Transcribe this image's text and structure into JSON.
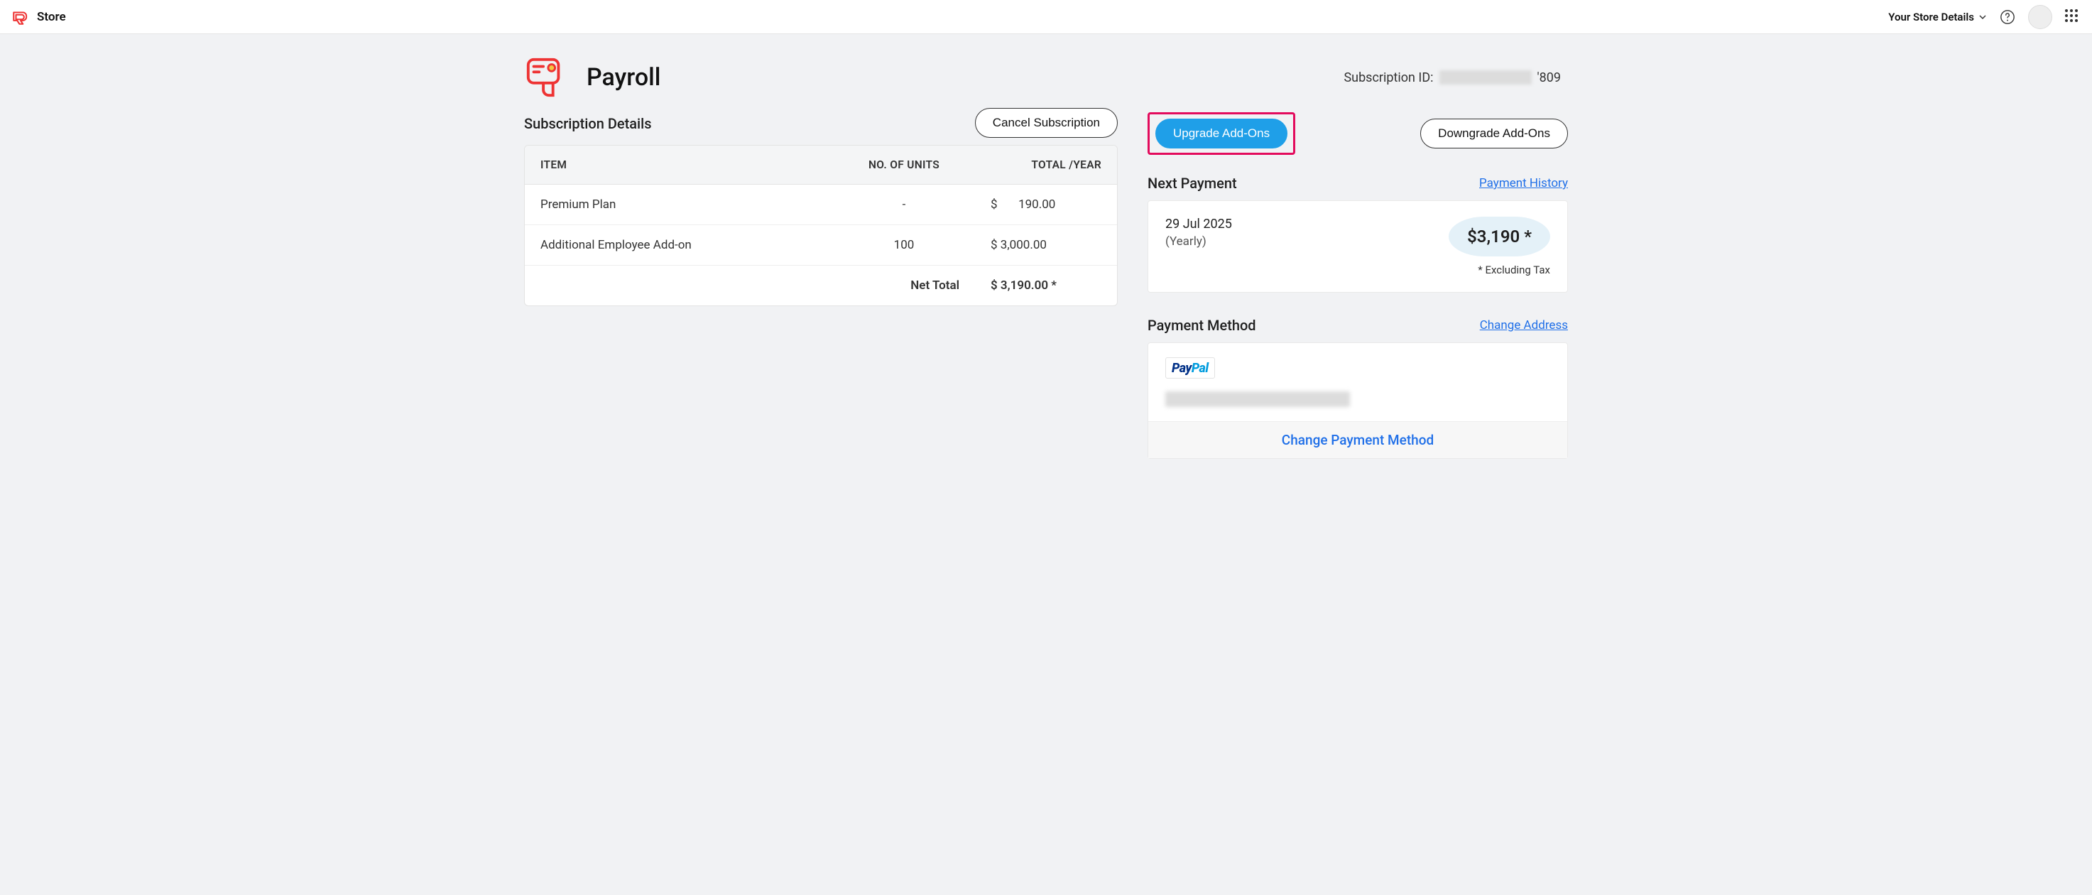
{
  "topbar": {
    "store_label": "Store",
    "store_details_label": "Your Store Details"
  },
  "header": {
    "title": "Payroll",
    "sub_id_label": "Subscription ID:",
    "sub_id_suffix": "'809"
  },
  "actions": {
    "cancel": "Cancel Subscription",
    "upgrade": "Upgrade Add-Ons",
    "downgrade": "Downgrade Add-Ons"
  },
  "details": {
    "heading": "Subscription Details",
    "cols": {
      "item": "ITEM",
      "units": "NO. OF UNITS",
      "total": "TOTAL /YEAR"
    },
    "rows": [
      {
        "item": "Premium Plan",
        "units": "-",
        "total": "$       190.00"
      },
      {
        "item": "Additional Employee Add-on",
        "units": "100",
        "total": "$ 3,000.00"
      }
    ],
    "net_total_label": "Net Total",
    "net_total_value": "$ 3,190.00 *"
  },
  "next_payment": {
    "heading": "Next Payment",
    "history_link": "Payment History",
    "date": "29 Jul 2025",
    "term": "(Yearly)",
    "amount": "$3,190 *",
    "excl_tax": "* Excluding Tax"
  },
  "payment_method": {
    "heading": "Payment Method",
    "change_address_link": "Change Address",
    "provider_pay": "Pay",
    "provider_pal": "Pal",
    "change_method": "Change Payment Method"
  }
}
